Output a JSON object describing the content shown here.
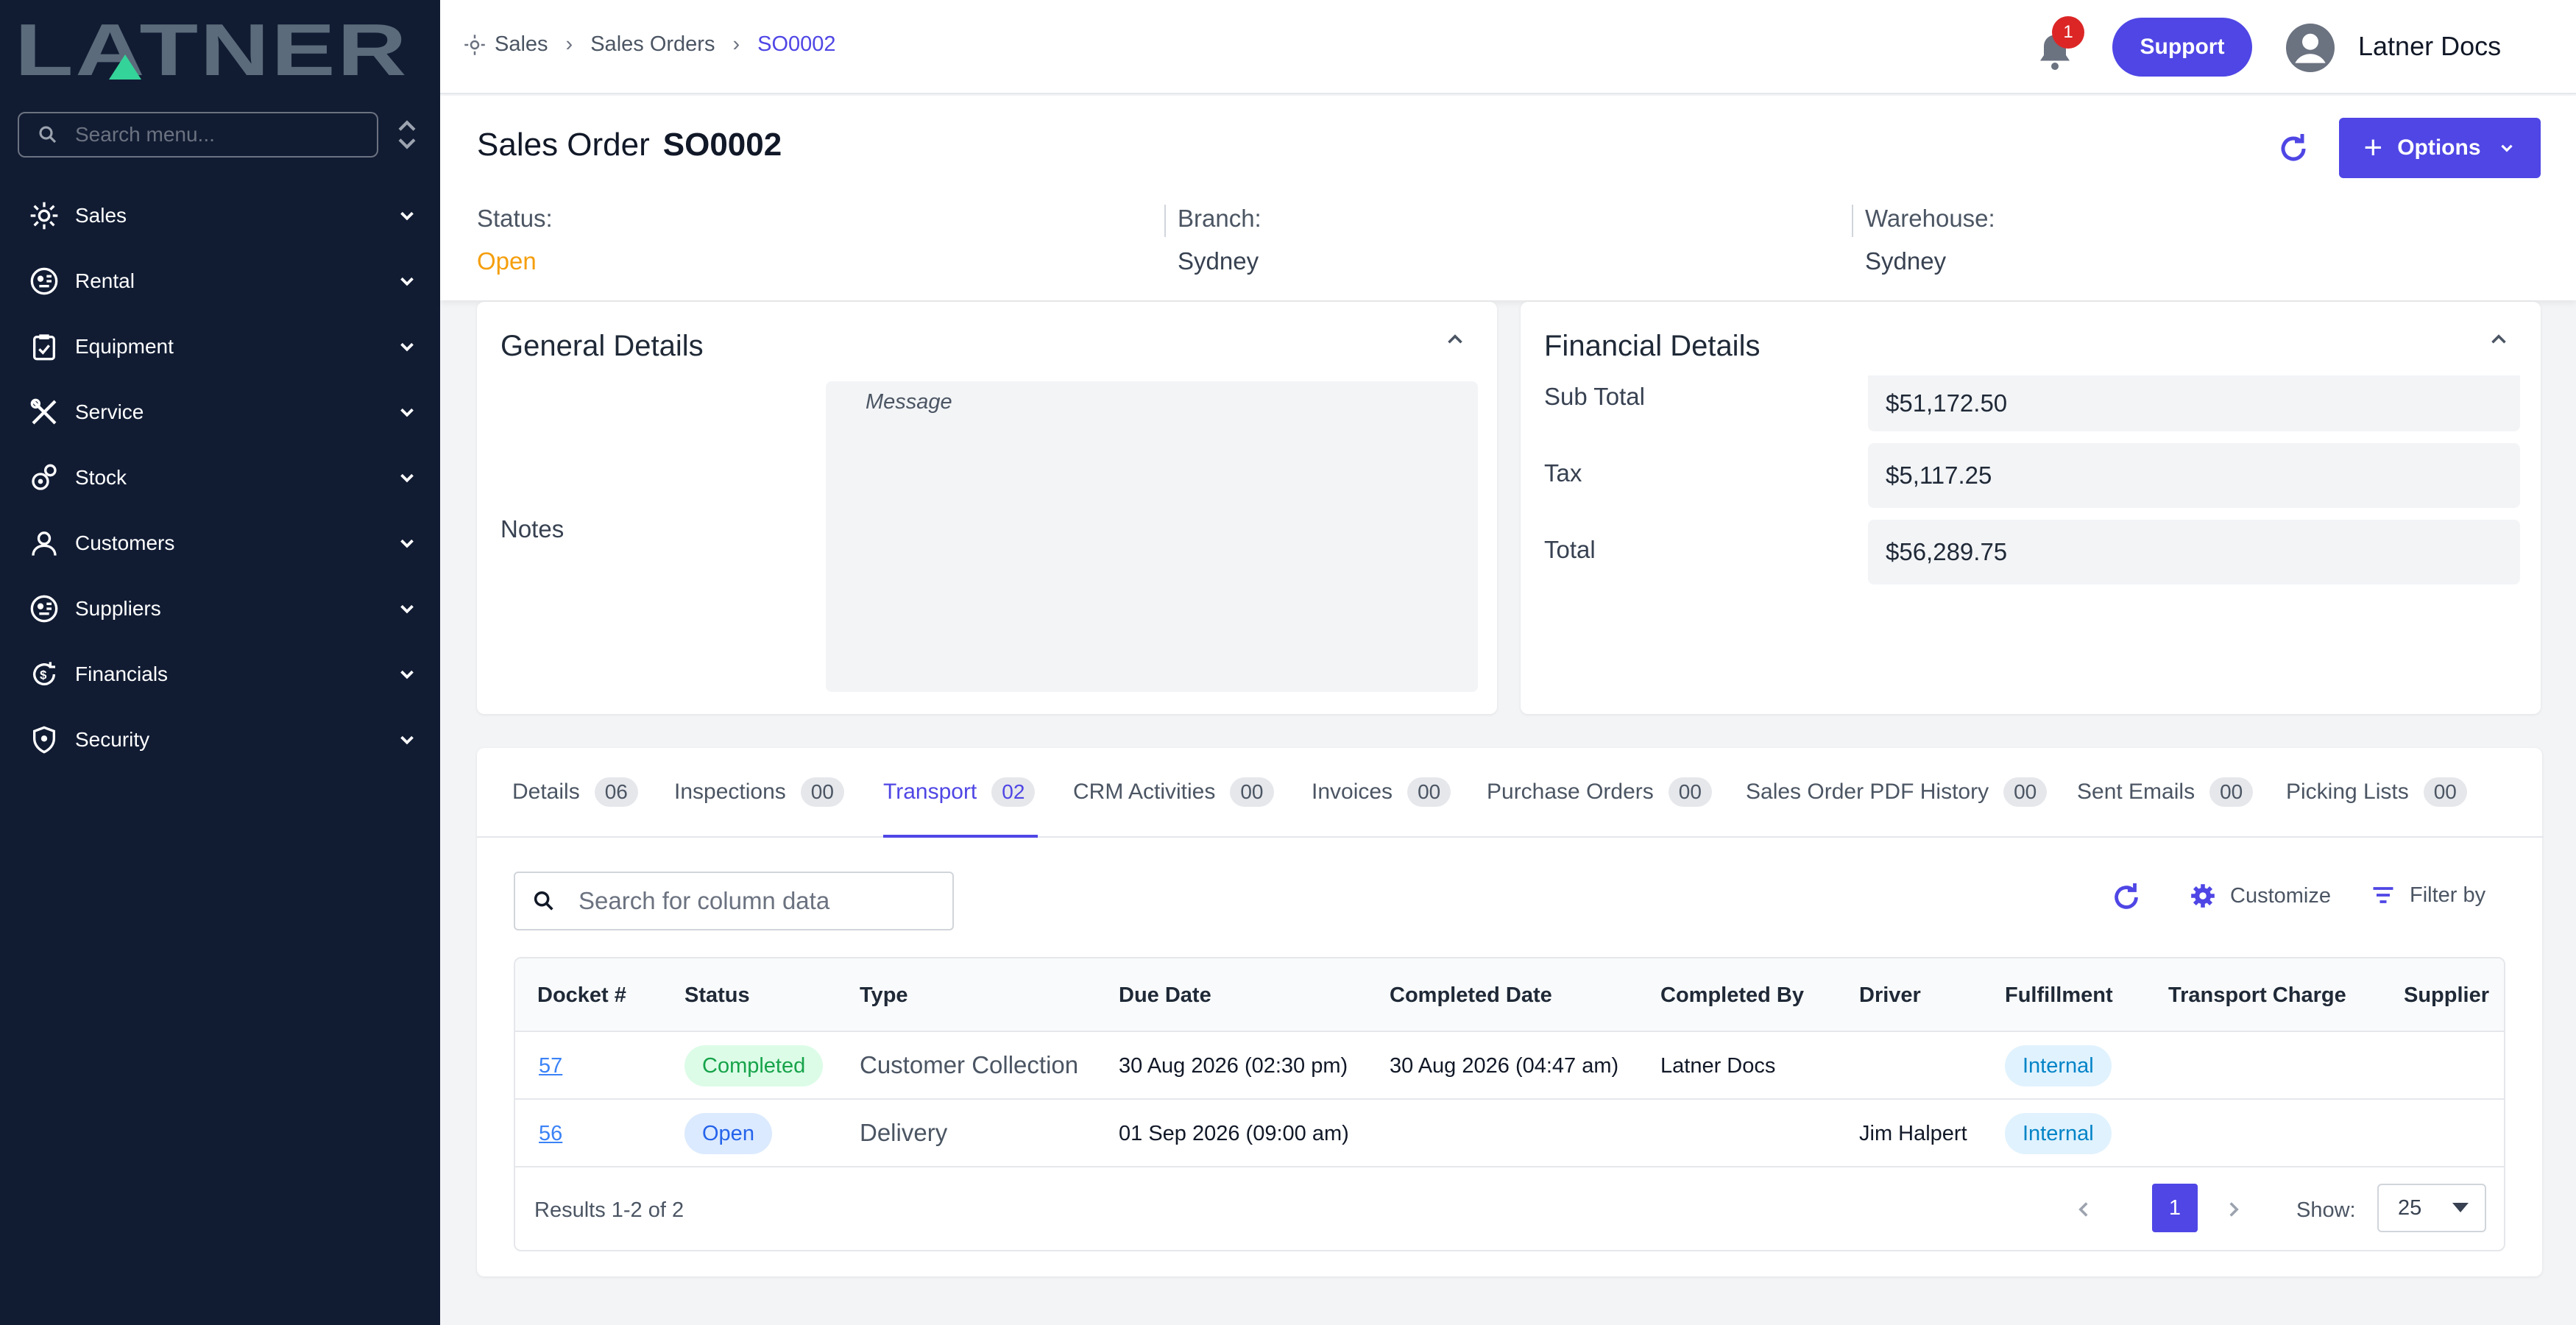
{
  "app": {
    "logo_text": "LATNER"
  },
  "sidebar": {
    "search_placeholder": "Search menu...",
    "items": [
      {
        "label": "Sales",
        "icon": "sales-icon"
      },
      {
        "label": "Rental",
        "icon": "rental-icon"
      },
      {
        "label": "Equipment",
        "icon": "equipment-icon"
      },
      {
        "label": "Service",
        "icon": "service-icon"
      },
      {
        "label": "Stock",
        "icon": "stock-icon"
      },
      {
        "label": "Customers",
        "icon": "customers-icon"
      },
      {
        "label": "Suppliers",
        "icon": "suppliers-icon"
      },
      {
        "label": "Financials",
        "icon": "financials-icon"
      },
      {
        "label": "Security",
        "icon": "security-icon"
      }
    ]
  },
  "header": {
    "breadcrumb": [
      "Sales",
      "Sales Orders",
      "SO0002"
    ],
    "notification_count": "1",
    "support_label": "Support",
    "user_name": "Latner Docs"
  },
  "order": {
    "title_prefix": "Sales Order",
    "number": "SO0002",
    "options_label": "Options",
    "status_label": "Status:",
    "status_value": "Open",
    "branch_label": "Branch:",
    "branch_value": "Sydney",
    "warehouse_label": "Warehouse:",
    "warehouse_value": "Sydney"
  },
  "general": {
    "title": "General Details",
    "notes_label": "Notes",
    "notes_placeholder": "Message"
  },
  "financial": {
    "title": "Financial Details",
    "rows": [
      {
        "label": "Sub Total",
        "value": "$51,172.50"
      },
      {
        "label": "Tax",
        "value": "$5,117.25"
      },
      {
        "label": "Total",
        "value": "$56,289.75"
      }
    ]
  },
  "tabs": [
    {
      "label": "Details",
      "count": "06"
    },
    {
      "label": "Inspections",
      "count": "00"
    },
    {
      "label": "Transport",
      "count": "02"
    },
    {
      "label": "CRM Activities",
      "count": "00"
    },
    {
      "label": "Invoices",
      "count": "00"
    },
    {
      "label": "Purchase Orders",
      "count": "00"
    },
    {
      "label": "Sales Order PDF History",
      "count": "00"
    },
    {
      "label": "Sent Emails",
      "count": "00"
    },
    {
      "label": "Picking Lists",
      "count": "00"
    }
  ],
  "toolbar": {
    "search_placeholder": "Search for column data",
    "customize_label": "Customize",
    "filter_label": "Filter by"
  },
  "table": {
    "headers": [
      "Docket #",
      "Status",
      "Type",
      "Due Date",
      "Completed Date",
      "Completed By",
      "Driver",
      "Fulfillment",
      "Transport Charge",
      "Supplier"
    ],
    "rows": [
      {
        "docket": "57",
        "status": "Completed",
        "type": "Customer Collection",
        "due": "30 Aug 2026 (02:30 pm)",
        "completed": "30 Aug 2026 (04:47 am)",
        "completed_by": "Latner Docs",
        "driver": "",
        "fulfillment": "Internal"
      },
      {
        "docket": "56",
        "status": "Open",
        "type": "Delivery",
        "due": "01 Sep 2026 (09:00 am)",
        "completed": "",
        "completed_by": "",
        "driver": "Jim Halpert",
        "fulfillment": "Internal"
      }
    ],
    "results_text": "Results 1-2 of 2",
    "current_page": "1",
    "show_label": "Show:",
    "page_size": "25"
  },
  "colors": {
    "accent": "#4f46e5",
    "sidebar_bg": "#111c33",
    "status_open": "#f59e0b"
  }
}
